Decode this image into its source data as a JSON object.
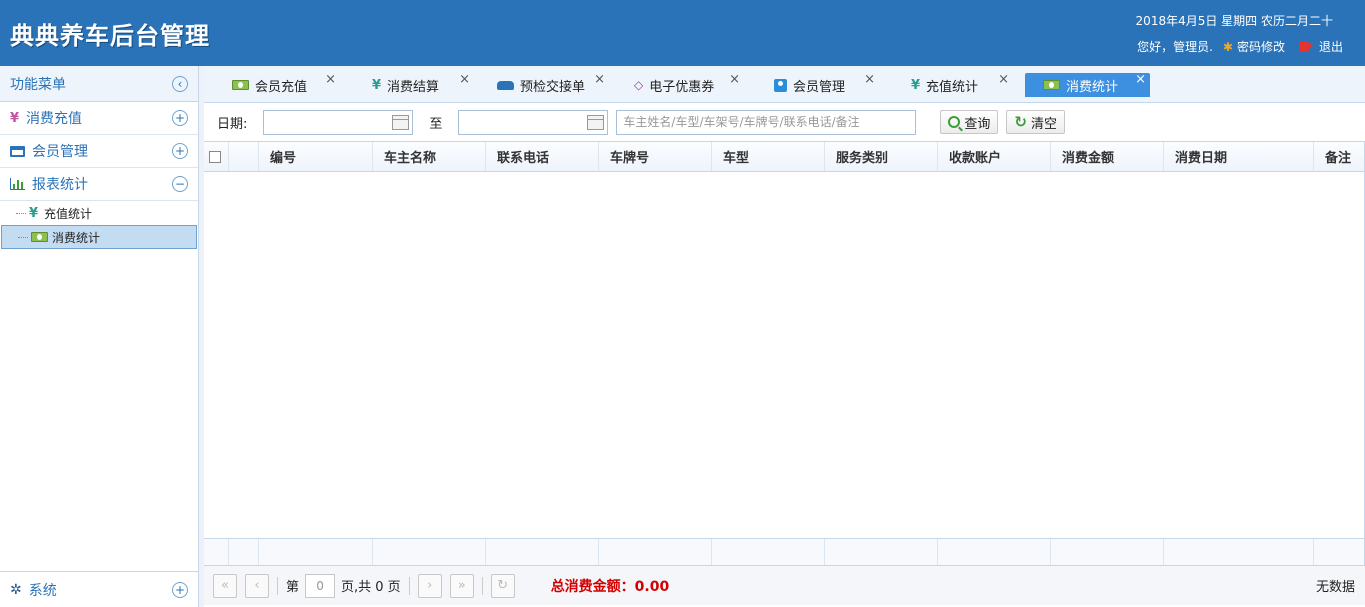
{
  "header": {
    "title": "典典养车后台管理",
    "date": "2018年4月5日 星期四 农历二月二十",
    "greeting": "您好，管理员.",
    "change_password": "密码修改",
    "logout": "退出"
  },
  "sidebar": {
    "title": "功能菜单",
    "sections": [
      {
        "label": "消费充值",
        "icon": "yen-icon"
      },
      {
        "label": "会员管理",
        "icon": "card-icon"
      },
      {
        "label": "报表统计",
        "icon": "chart-icon",
        "expanded": true
      }
    ],
    "sub_items": [
      {
        "label": "充值统计",
        "icon": "yen-icon"
      },
      {
        "label": "消费统计",
        "icon": "money-icon",
        "active": true
      }
    ],
    "bottom": {
      "label": "系统",
      "icon": "gear-icon"
    }
  },
  "tabs": [
    {
      "label": "会员充值",
      "icon": "money-icon"
    },
    {
      "label": "消费结算",
      "icon": "yen-icon"
    },
    {
      "label": "预检交接单",
      "icon": "car-icon"
    },
    {
      "label": "电子优惠券",
      "icon": "coupon-icon"
    },
    {
      "label": "会员管理",
      "icon": "user-icon"
    },
    {
      "label": "充值统计",
      "icon": "yen-icon"
    },
    {
      "label": "消费统计",
      "icon": "money-icon",
      "active": true
    }
  ],
  "tab_close": "×",
  "toolbar": {
    "date_label": "日期:",
    "to_label": "至",
    "search_placeholder": "车主姓名/车型/车架号/车牌号/联系电话/备注",
    "query_button": "查询",
    "clear_button": "清空"
  },
  "grid": {
    "columns": [
      "编号",
      "车主名称",
      "联系电话",
      "车牌号",
      "车型",
      "服务类别",
      "收款账户",
      "消费金额",
      "消费日期",
      "备注"
    ],
    "rows": []
  },
  "pager": {
    "page_prefix": "第",
    "page_value": "0",
    "page_suffix": "页,共 0 页",
    "total_label": "总消费金额：0.00",
    "empty_text": "无数据"
  },
  "colors": {
    "header_bg": "#2a73b8",
    "active_tab": "#3d8fe0",
    "total_text": "#d40000"
  }
}
